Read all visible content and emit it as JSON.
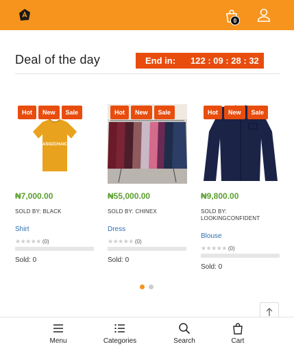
{
  "header": {
    "logo": "app-logo",
    "cart_count": "0",
    "icons": [
      "cart-icon",
      "user-icon"
    ]
  },
  "deal": {
    "title": "Deal of the day",
    "countdown_label": "End in:",
    "countdown_value": "122 : 09 : 28 : 32"
  },
  "products": [
    {
      "badges": [
        "Hot",
        "New",
        "Sale"
      ],
      "price": "₦7,000.00",
      "sold_by": "SOLD BY: BLACK",
      "category": "Shirt",
      "rating_count": "(0)",
      "sold": "Sold: 0",
      "sold_fraction": 0,
      "image_text": "ASOZCHAIC",
      "image": "mustard-tshirt"
    },
    {
      "badges": [
        "Hot",
        "New",
        "Sale"
      ],
      "price": "₦55,000.00",
      "sold_by": "SOLD BY: CHINEX",
      "category": "Dress",
      "rating_count": "(0)",
      "sold": "Sold: 0",
      "sold_fraction": 0,
      "image": "dresses-on-rack"
    },
    {
      "badges": [
        "Hot",
        "New",
        "Sale"
      ],
      "price": "₦9,800.00",
      "sold_by": "SOLD BY: LOOKINGCONFIDENT",
      "category": "Blouse",
      "rating_count": "(0)",
      "sold": "Sold: 0",
      "sold_fraction": 0,
      "image": "navy-blouse"
    }
  ],
  "carousel": {
    "active_page": 1,
    "pages": 2
  },
  "bottom_nav": [
    {
      "label": "Menu",
      "icon": "menu-icon"
    },
    {
      "label": "Categories",
      "icon": "categories-icon"
    },
    {
      "label": "Search",
      "icon": "search-icon"
    },
    {
      "label": "Cart",
      "icon": "cart-icon"
    }
  ],
  "colors": {
    "primary": "#f7941d",
    "badge": "#e84d0e",
    "price": "#5a9e2d",
    "category_link": "#2d6fb5"
  }
}
